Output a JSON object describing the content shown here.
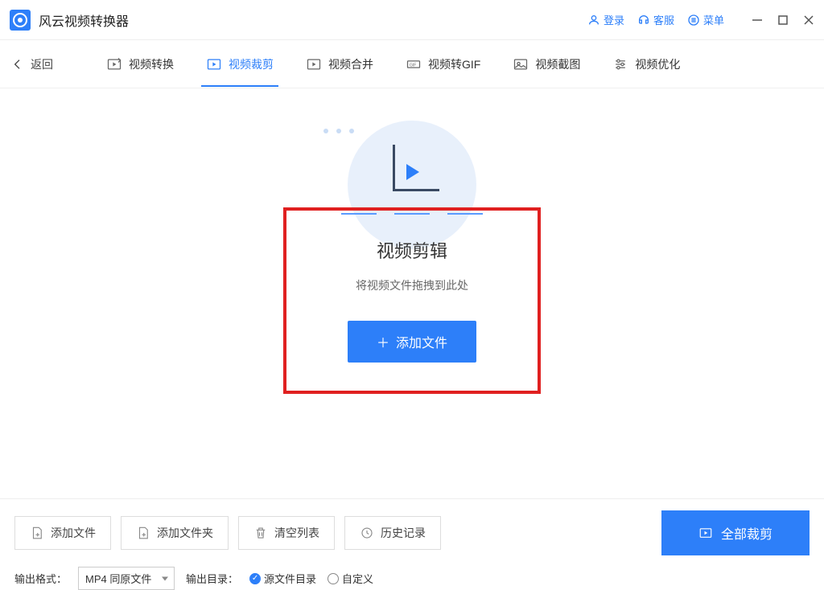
{
  "app": {
    "title": "风云视频转换器"
  },
  "titlebar": {
    "login": "登录",
    "support": "客服",
    "menu": "菜单"
  },
  "toolbar": {
    "back": "返回",
    "tabs": [
      {
        "label": "视频转换"
      },
      {
        "label": "视频裁剪"
      },
      {
        "label": "视频合并"
      },
      {
        "label": "视频转GIF"
      },
      {
        "label": "视频截图"
      },
      {
        "label": "视频优化"
      }
    ],
    "active_index": 1
  },
  "main": {
    "heading": "视频剪辑",
    "subtitle": "将视频文件拖拽到此处",
    "add_file": "添加文件"
  },
  "bottom": {
    "add_file": "添加文件",
    "add_folder": "添加文件夹",
    "clear_list": "清空列表",
    "history": "历史记录",
    "crop_all": "全部裁剪",
    "output_format_label": "输出格式：",
    "output_format_value": "MP4 同原文件",
    "output_dir_label": "输出目录：",
    "output_dir_source": "源文件目录",
    "output_dir_custom": "自定义"
  }
}
